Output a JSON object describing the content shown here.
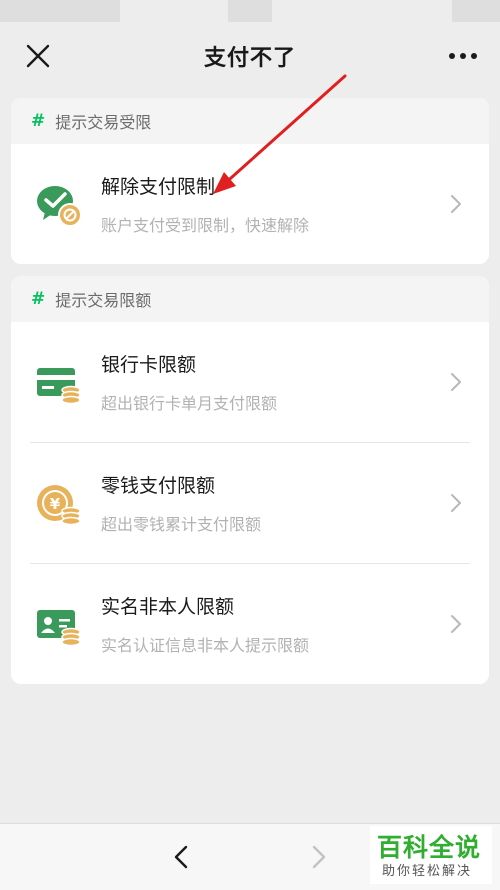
{
  "header": {
    "title": "支付不了"
  },
  "sections": [
    {
      "label": "提示交易受限",
      "items": [
        {
          "title": "解除支付限制",
          "subtitle": "账户支付受到限制，快速解除",
          "icon": "wechat-pay-restricted-icon"
        }
      ]
    },
    {
      "label": "提示交易限额",
      "items": [
        {
          "title": "银行卡限额",
          "subtitle": "超出银行卡单月支付限额",
          "icon": "bank-card-icon"
        },
        {
          "title": "零钱支付限额",
          "subtitle": "超出零钱累计支付限额",
          "icon": "change-wallet-icon"
        },
        {
          "title": "实名非本人限额",
          "subtitle": "实名认证信息非本人提示限额",
          "icon": "id-card-icon"
        }
      ]
    }
  ],
  "watermark": {
    "line1": "百科全说",
    "line2": "助你轻松解决"
  },
  "colors": {
    "accent_green": "#07c160",
    "icon_green": "#3a9a5b",
    "coin_orange": "#e8b25a",
    "annotation_red": "#e02020"
  }
}
